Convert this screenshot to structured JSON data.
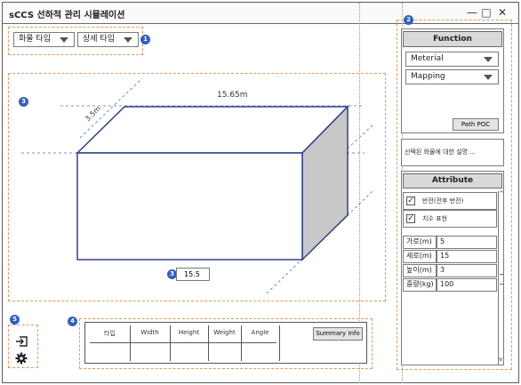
{
  "window": {
    "title": "sCCS 선하적 관리 시뮬레이션",
    "controls": [
      "—",
      "□",
      "✕"
    ]
  },
  "badges": [
    "1",
    "2",
    "3",
    "3",
    "4",
    "5"
  ],
  "selectors": {
    "cargo_type": "화물 타입",
    "detail_type": "상세 타입"
  },
  "canvas": {
    "dim_length": "15.65m",
    "dim_depth": "3.5m",
    "value_input": "15.5"
  },
  "function_panel": {
    "header": "Function",
    "material": "Meterial",
    "mapping": "Mapping",
    "path_button": "Path POC",
    "description": "선택된 화물에 대한 설명 ..."
  },
  "attribute_panel": {
    "header": "Attribute",
    "checks": [
      {
        "label": "반전(전후 반전)",
        "checked": true
      },
      {
        "label": "치수 표현",
        "checked": true
      }
    ],
    "fields": [
      {
        "label": "가로(m)",
        "value": "5"
      },
      {
        "label": "세로(m)",
        "value": "15"
      },
      {
        "label": "높이(m)",
        "value": "3"
      },
      {
        "label": "중량(kg)",
        "value": "100"
      }
    ]
  },
  "summary_table": {
    "columns": [
      "타입",
      "Width",
      "Height",
      "Weight",
      "Angle"
    ],
    "button": "Summary Info"
  },
  "side_icons": [
    "import-icon",
    "gear-icon"
  ]
}
